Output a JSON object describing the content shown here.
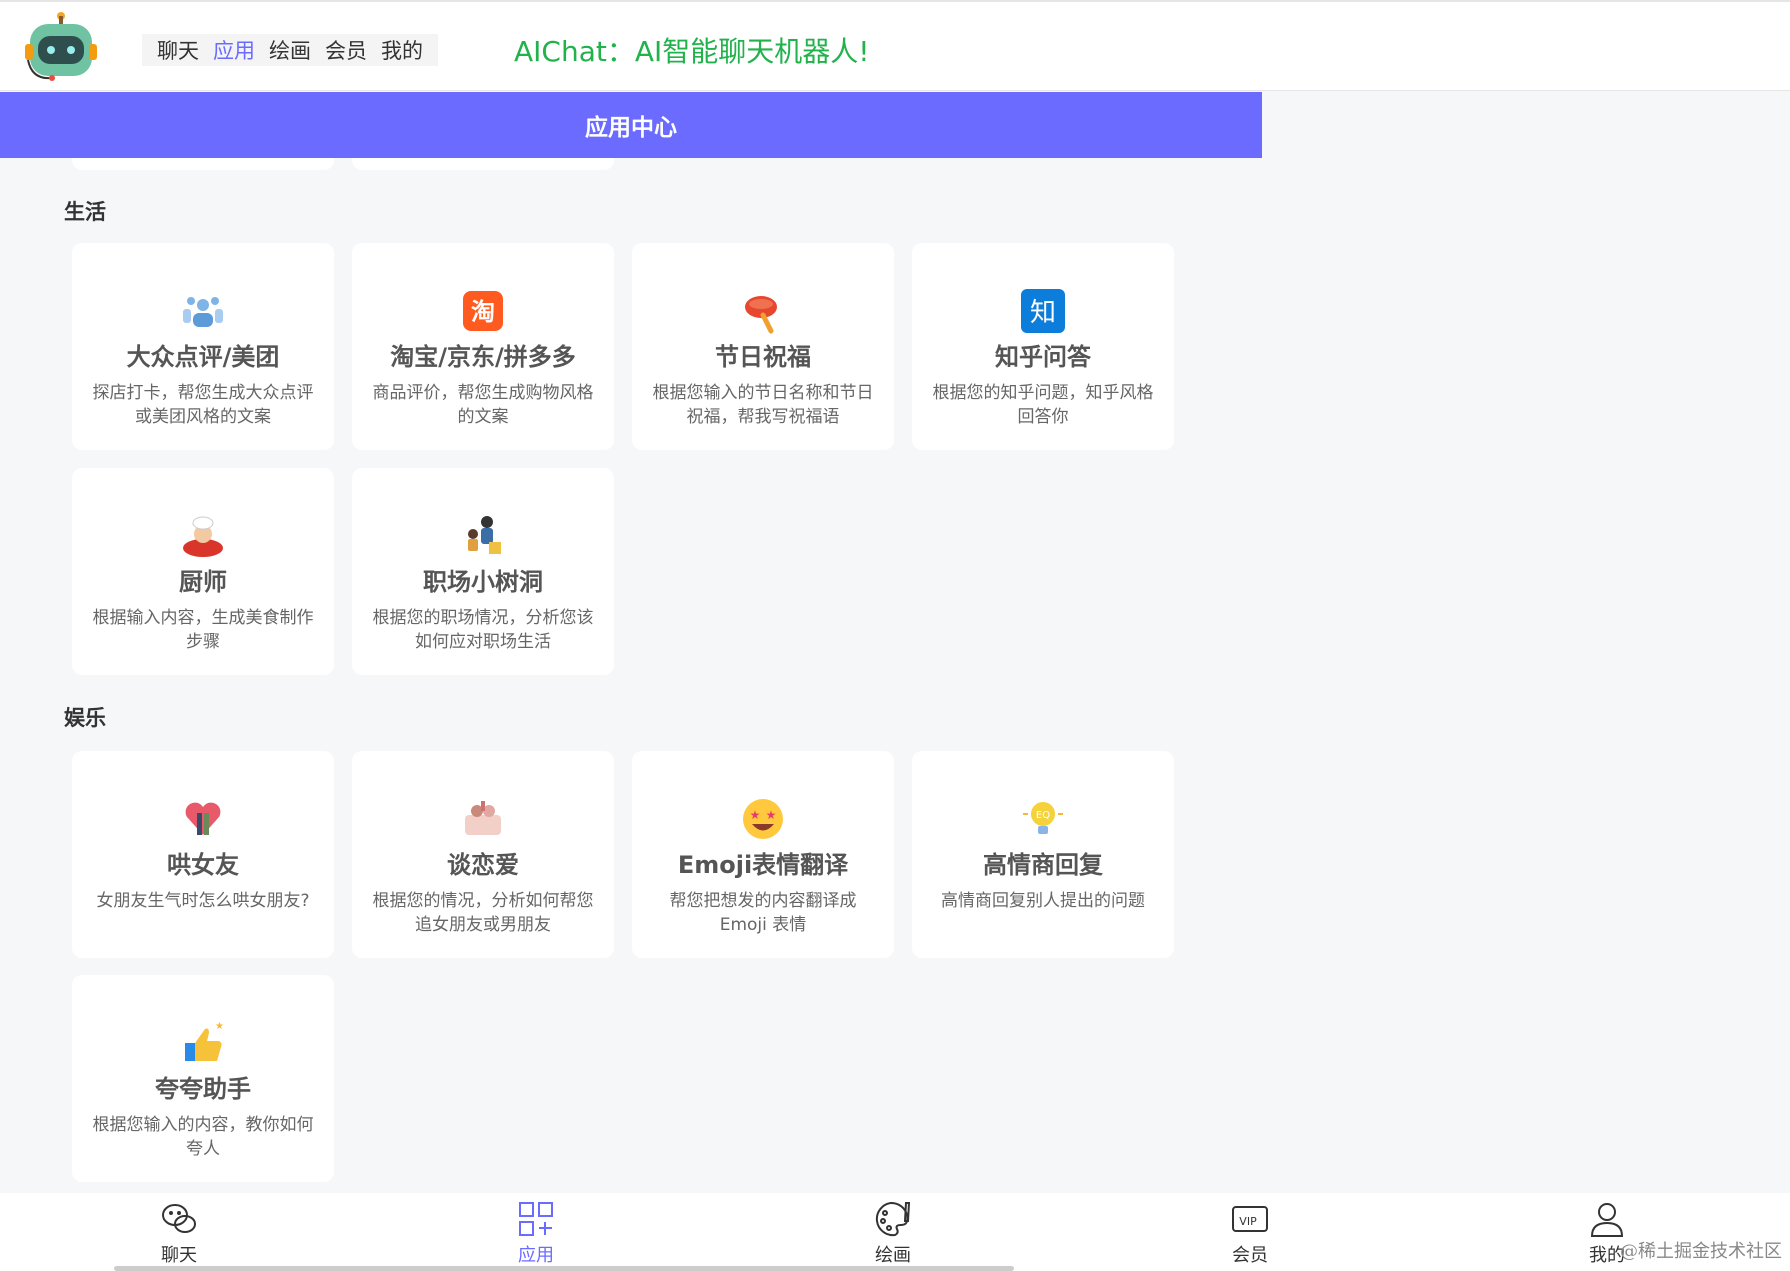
{
  "header": {
    "nav": [
      "聊天",
      "应用",
      "绘画",
      "会员",
      "我的"
    ],
    "active_index": 1,
    "slogan": "AIChat：AI智能聊天机器人!"
  },
  "banner": {
    "title": "应用中心"
  },
  "sections": [
    {
      "title": "生活",
      "cards": [
        {
          "title": "大众点评/美团",
          "desc": "探店打卡，帮您生成大众点评或美团风格的文案",
          "icon": "review-icon"
        },
        {
          "title": "淘宝/京东/拼多多",
          "desc": "商品评价，帮您生成购物风格的文案",
          "icon": "taobao-icon"
        },
        {
          "title": "节日祝福",
          "desc": "根据您输入的节日名称和节日祝福，帮我写祝福语",
          "icon": "lantern-icon"
        },
        {
          "title": "知乎问答",
          "desc": "根据您的知乎问题，知乎风格回答你",
          "icon": "zhihu-icon"
        },
        {
          "title": "厨师",
          "desc": "根据输入内容，生成美食制作步骤",
          "icon": "chef-icon"
        },
        {
          "title": "职场小树洞",
          "desc": "根据您的职场情况，分析您该如何应对职场生活",
          "icon": "workplace-icon"
        }
      ]
    },
    {
      "title": "娱乐",
      "cards": [
        {
          "title": "哄女友",
          "desc": "女朋友生气时怎么哄女朋友?",
          "icon": "couple-icon"
        },
        {
          "title": "谈恋爱",
          "desc": "根据您的情况，分析如何帮您追女朋友或男朋友",
          "icon": "dating-icon"
        },
        {
          "title": "Emoji表情翻译",
          "desc": "帮您把想发的内容翻译成 Emoji 表情",
          "icon": "emoji-icon"
        },
        {
          "title": "高情商回复",
          "desc": "高情商回复别人提出的问题",
          "icon": "bulb-icon"
        },
        {
          "title": "夸夸助手",
          "desc": "根据您输入的内容，教你如何夸人",
          "icon": "thumbs-up-icon"
        }
      ]
    }
  ],
  "bottom_nav": [
    {
      "label": "聊天",
      "icon": "wechat-icon"
    },
    {
      "label": "应用",
      "icon": "apps-icon",
      "active": true
    },
    {
      "label": "绘画",
      "icon": "palette-icon"
    },
    {
      "label": "会员",
      "icon": "vip-icon"
    },
    {
      "label": "我的",
      "icon": "user-icon"
    }
  ],
  "watermark": "@稀土掘金技术社区",
  "colors": {
    "accent": "#6b6cff",
    "slogan": "#22b24c"
  }
}
